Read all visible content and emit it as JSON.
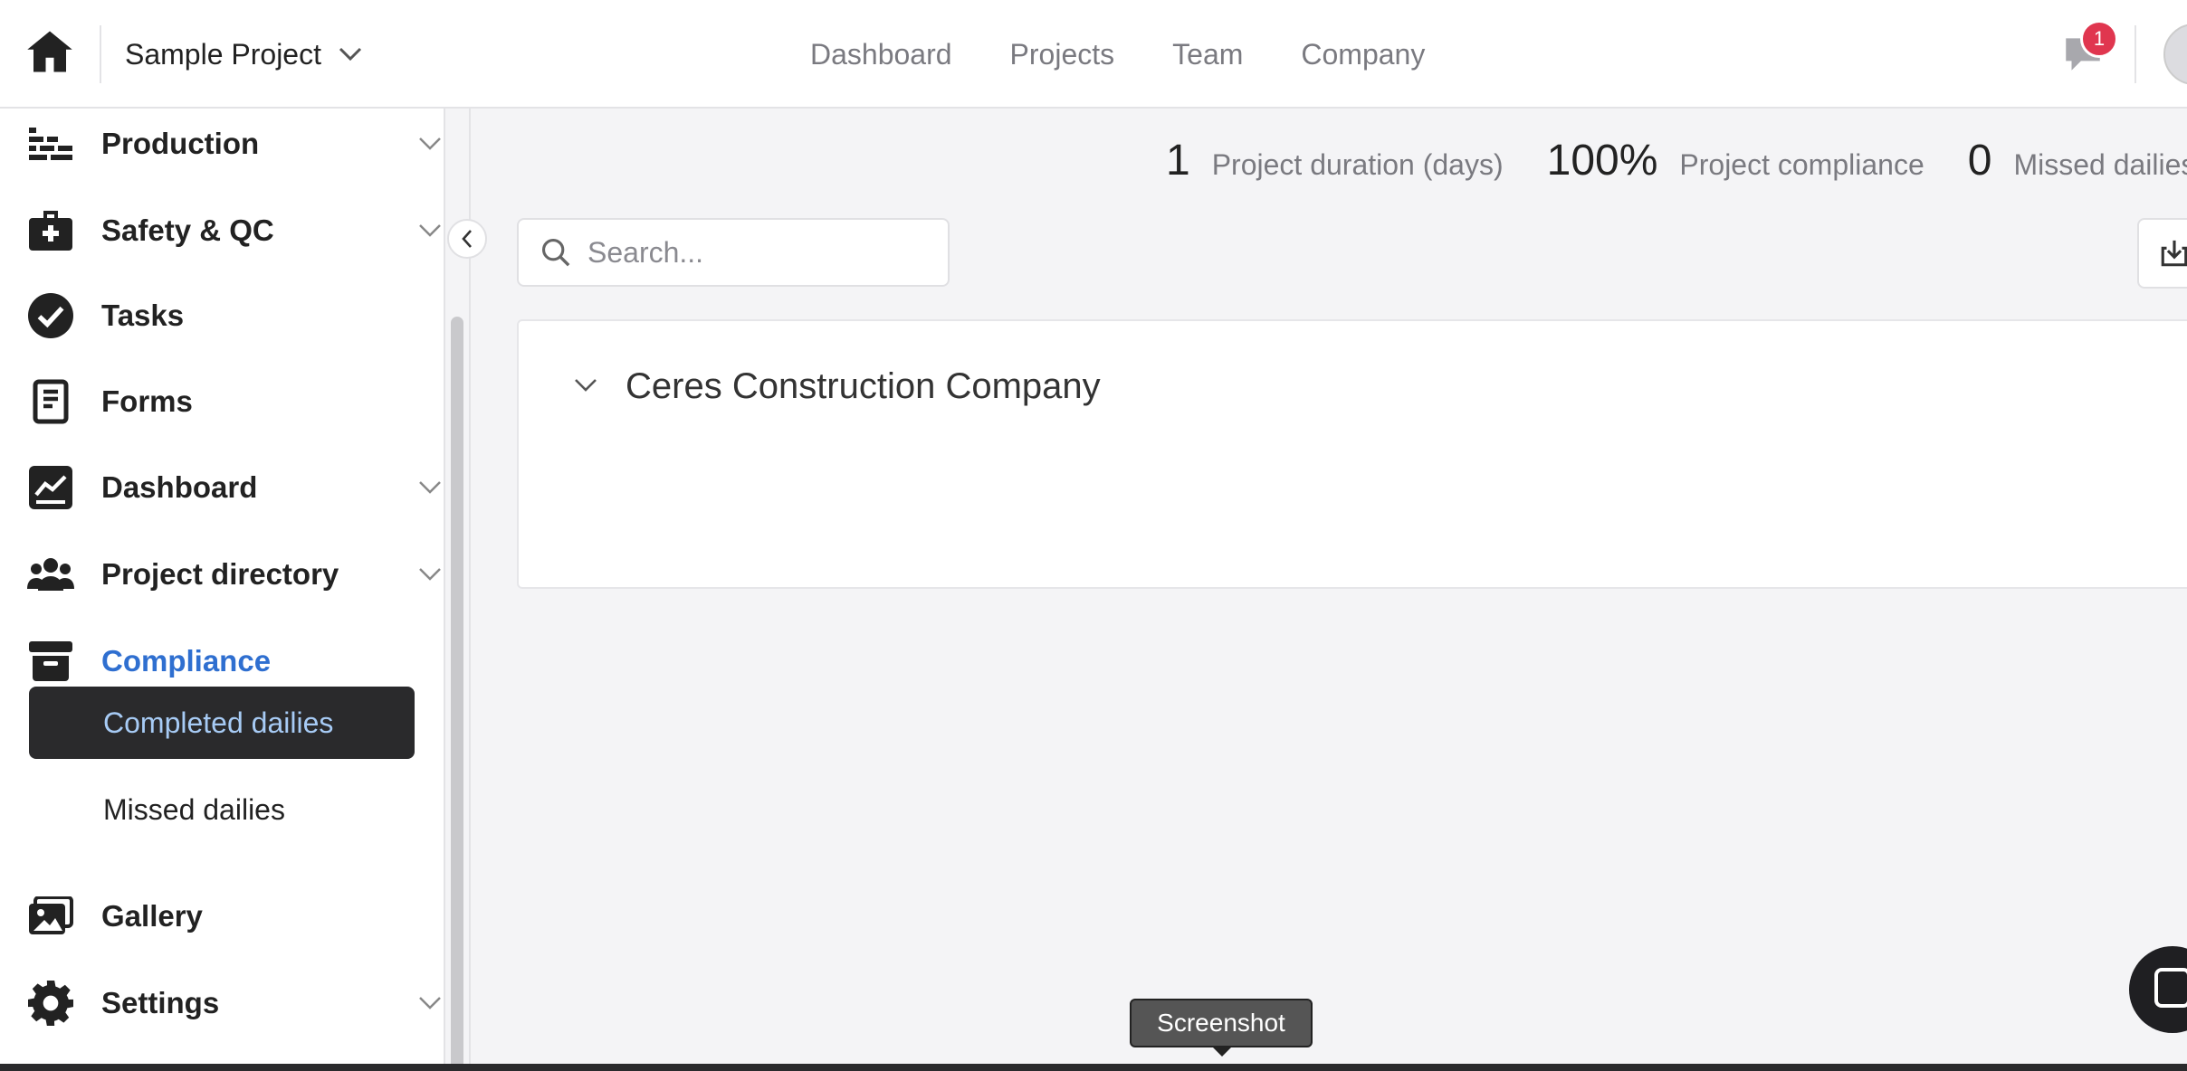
{
  "header": {
    "project_name": "Sample Project",
    "nav": [
      "Dashboard",
      "Projects",
      "Team",
      "Company"
    ],
    "notification_count": "1"
  },
  "sidebar": {
    "items": [
      {
        "label": "Production",
        "icon": "production-icon",
        "has_chevron": true
      },
      {
        "label": "Safety & QC",
        "icon": "first-aid-kit-icon",
        "has_chevron": true
      },
      {
        "label": "Tasks",
        "icon": "check-circle-icon",
        "has_chevron": false
      },
      {
        "label": "Forms",
        "icon": "form-icon",
        "has_chevron": false
      },
      {
        "label": "Dashboard",
        "icon": "chart-icon",
        "has_chevron": true
      },
      {
        "label": "Project directory",
        "icon": "people-icon",
        "has_chevron": true
      },
      {
        "label": "Compliance",
        "icon": "archive-icon",
        "has_chevron": false,
        "active": true
      },
      {
        "label": "Gallery",
        "icon": "gallery-icon",
        "has_chevron": false
      },
      {
        "label": "Settings",
        "icon": "gear-icon",
        "has_chevron": true
      }
    ],
    "compliance_subitems": [
      "Completed dailies",
      "Missed dailies"
    ],
    "selected_subitem": "Completed dailies"
  },
  "stats": [
    {
      "value": "1",
      "label": "Project duration (days)"
    },
    {
      "value": "100%",
      "label": "Project compliance"
    },
    {
      "value": "0",
      "label": "Missed dailies"
    }
  ],
  "search": {
    "placeholder": "Search..."
  },
  "card": {
    "company": "Ceres Construction Company"
  },
  "tooltip": "Screenshot",
  "colors": {
    "accent": "#2f6fd0",
    "selected_bg": "#2a2a2c",
    "selected_text": "#a7cbf5",
    "badge": "#e0364f"
  }
}
